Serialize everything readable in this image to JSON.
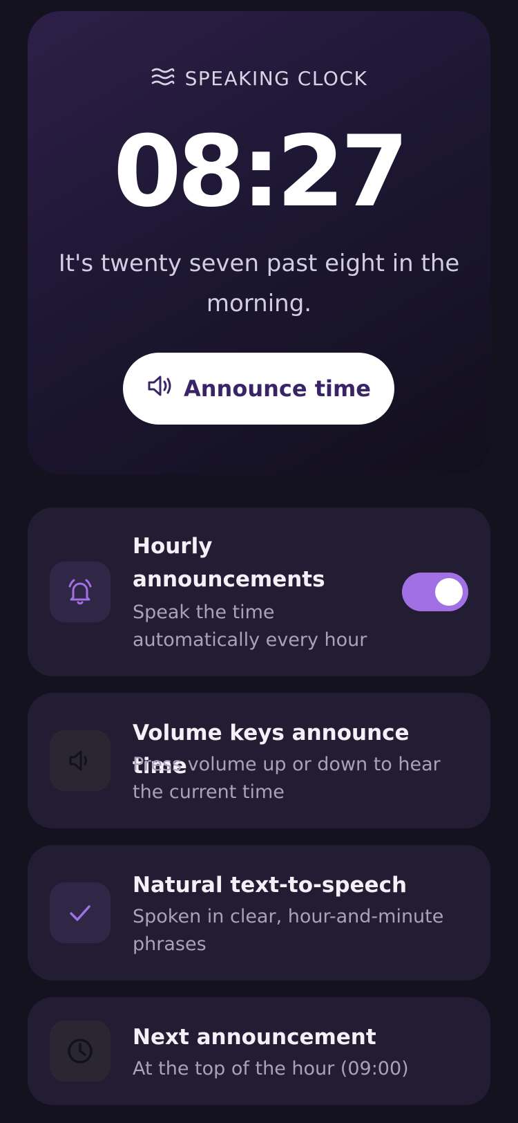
{
  "header": {
    "title": "SPEAKING CLOCK",
    "icon": "waves-icon"
  },
  "clock": {
    "time": "08:27",
    "phrase": "It's twenty seven past eight in the morning."
  },
  "announce_button": {
    "label": "Announce time",
    "icon": "speaker-icon"
  },
  "settings": [
    {
      "title": "Hourly announcements",
      "description": "Speak the time automatically every hour",
      "icon": "bell-icon",
      "toggle": true
    },
    {
      "title": "Volume keys announce time",
      "description": "Press volume up or down to hear the current time",
      "icon": "speaker-icon"
    },
    {
      "title": "Natural text-to-speech",
      "description": "Spoken in clear, hour-and-minute phrases",
      "icon": "check-icon"
    },
    {
      "title": "Next announcement",
      "description": "At the top of the hour (09:00)",
      "icon": "clock-icon"
    }
  ],
  "colors": {
    "background": "#15121f",
    "card": "#221d33",
    "accent": "#a070e4",
    "button_text": "#3a2468"
  }
}
